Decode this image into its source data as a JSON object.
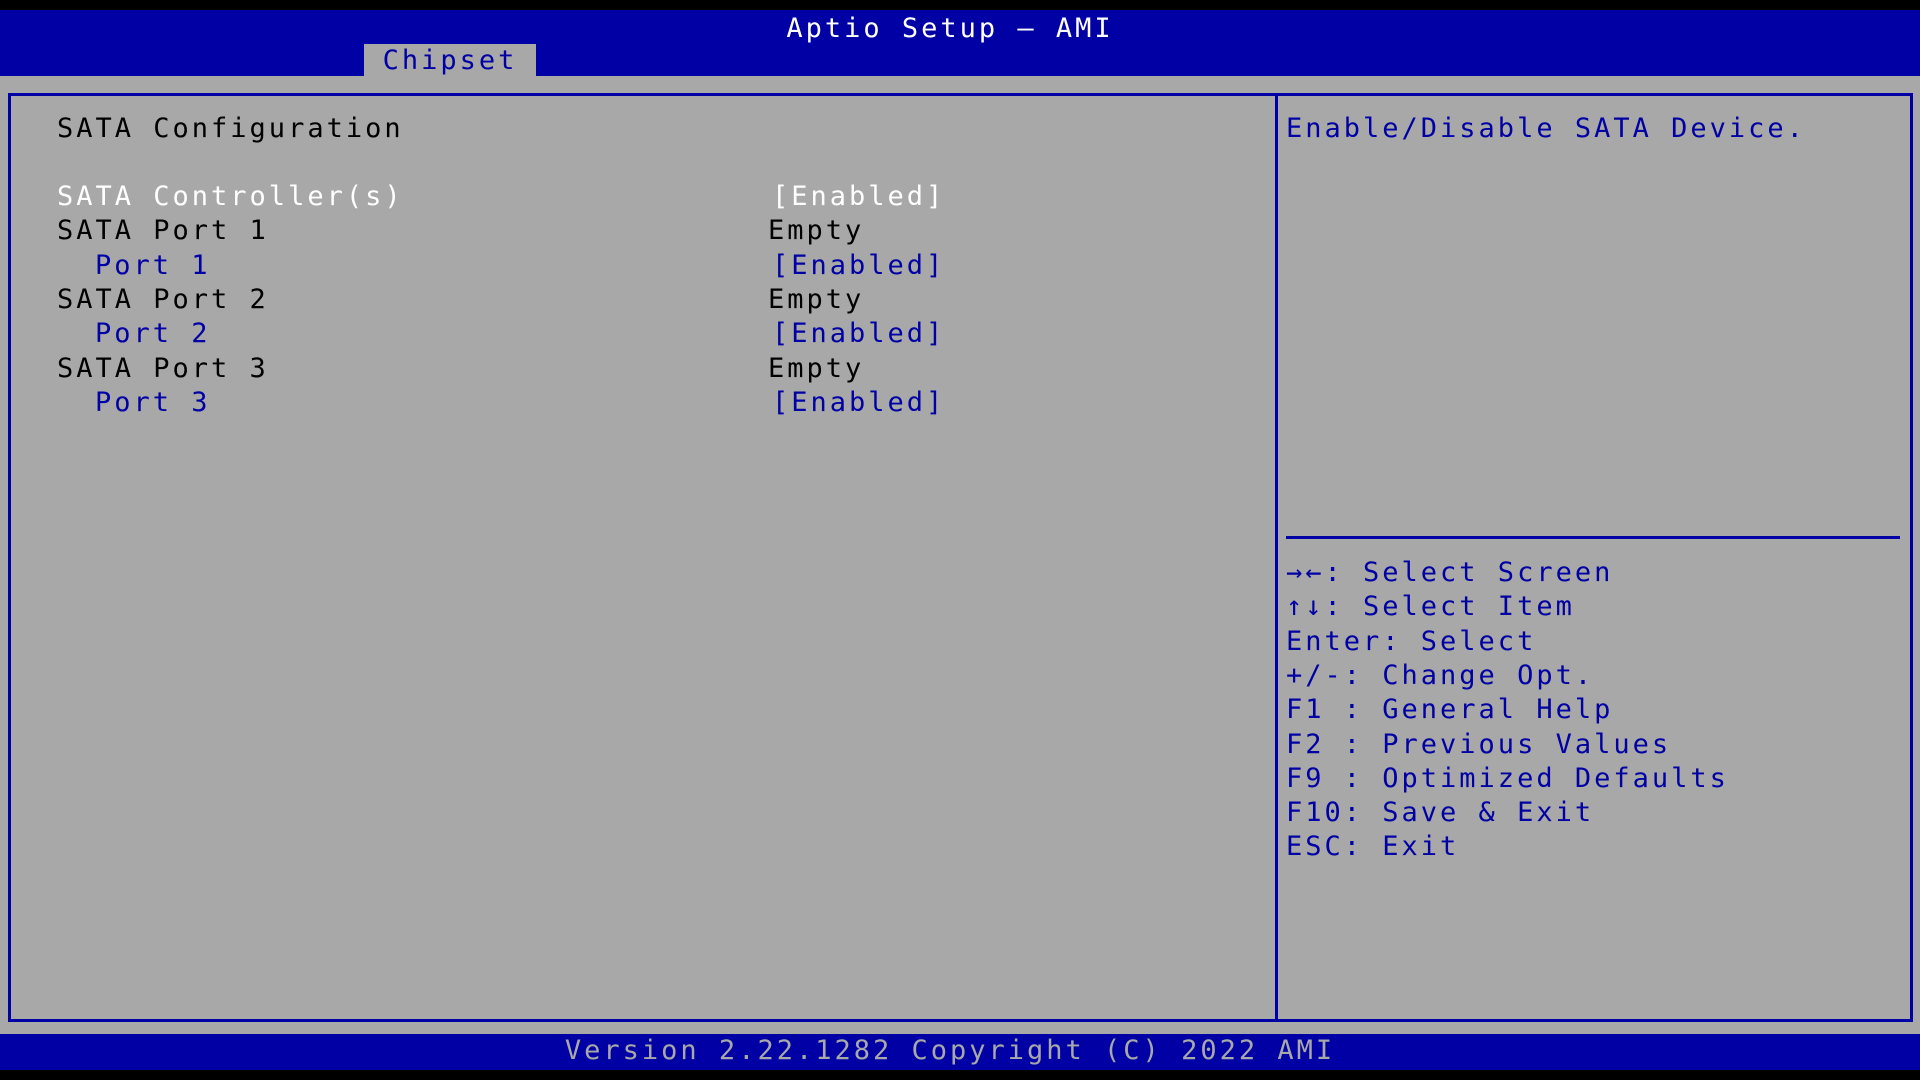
{
  "app": {
    "title": "Aptio Setup – AMI",
    "active_tab": "Chipset"
  },
  "settings": {
    "section_title": "SATA Configuration",
    "controller": {
      "label": "SATA Controller(s)",
      "value": "[Enabled]"
    },
    "ports": [
      {
        "label": "SATA Port 1",
        "status": "Empty",
        "sub_label": "Port 1",
        "sub_value": "[Enabled]"
      },
      {
        "label": "SATA Port 2",
        "status": "Empty",
        "sub_label": "Port 2",
        "sub_value": "[Enabled]"
      },
      {
        "label": "SATA Port 3",
        "status": "Empty",
        "sub_label": "Port 3",
        "sub_value": "[Enabled]"
      }
    ]
  },
  "help": {
    "description": "Enable/Disable SATA Device.",
    "keys": [
      "→←: Select Screen",
      "↑↓: Select Item",
      "Enter: Select",
      "+/-: Change Opt.",
      "F1 : General Help",
      "F2 : Previous Values",
      "F9 : Optimized Defaults",
      "F10: Save & Exit",
      "ESC: Exit"
    ]
  },
  "footer": {
    "version": "Version 2.22.1282 Copyright (C) 2022 AMI"
  },
  "colors": {
    "bios_blue": "#0000a4",
    "bios_gray": "#a8a8a8",
    "text_white": "#ffffff",
    "text_black": "#000000"
  }
}
